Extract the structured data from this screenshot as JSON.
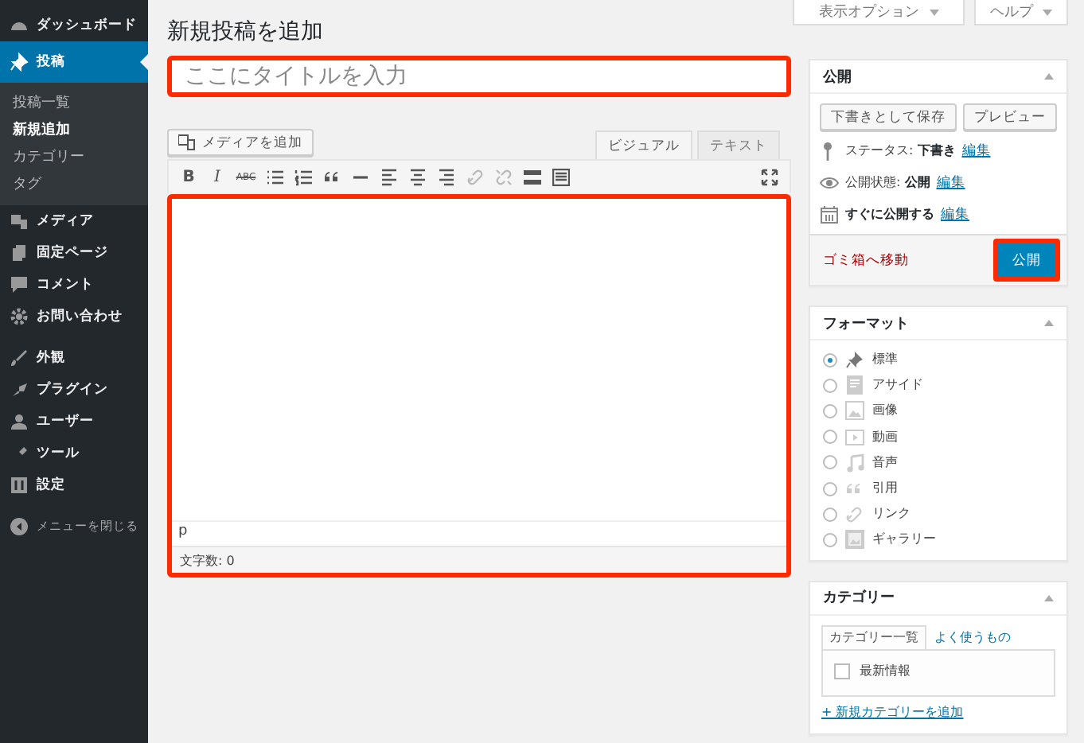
{
  "sidebar": {
    "menu_groups": [
      [
        {
          "label": "ダッシュボード",
          "selected": false
        },
        {
          "label": "投稿",
          "selected": true,
          "children": [
            {
              "label": "投稿一覧",
              "selected": false
            },
            {
              "label": "新規追加",
              "selected": true
            },
            {
              "label": "カテゴリー",
              "selected": false
            },
            {
              "label": "タグ",
              "selected": false
            }
          ]
        },
        {
          "label": "メディア",
          "selected": false
        },
        {
          "label": "固定ページ",
          "selected": false
        },
        {
          "label": "コメント",
          "selected": false
        },
        {
          "label": "お問い合わせ",
          "selected": false
        }
      ],
      [
        {
          "label": "外観",
          "selected": false
        },
        {
          "label": "プラグイン",
          "selected": false
        },
        {
          "label": "ユーザー",
          "selected": false
        },
        {
          "label": "ツール",
          "selected": false
        },
        {
          "label": "設定",
          "selected": false
        }
      ]
    ],
    "collapse": "メニューを閉じる"
  },
  "header_buttons": [
    "表示オプション",
    "ヘルプ"
  ],
  "page_title": "新規投稿を追加",
  "title_field": {
    "placeholder": "ここにタイトルを入力",
    "highlighted": true
  },
  "editor": {
    "media_button": "メディアを追加",
    "tabs": [
      {
        "label": "ビジュアル",
        "selected": true
      },
      {
        "label": "テキスト",
        "selected": false
      }
    ],
    "toolbar_text": [
      "B",
      "I",
      "ABC"
    ],
    "path": "p",
    "word_count": "文字数: 0",
    "highlighted": true
  },
  "publish": {
    "title": "公開",
    "save_draft": "下書きとして保存",
    "preview": "プレビュー",
    "rows": [
      {
        "text": "ステータス: **下書き**",
        "link": "編集"
      },
      {
        "text": "公開状態: **公開**",
        "link": "編集"
      },
      {
        "text": "**すぐに公開する**",
        "link": "編集"
      }
    ],
    "trash": "ゴミ箱へ移動",
    "button": {
      "label": "公開",
      "highlighted": true
    }
  },
  "format": {
    "title": "フォーマット",
    "options": [
      {
        "label": "標準",
        "selected": true
      },
      {
        "label": "アサイド",
        "selected": false
      },
      {
        "label": "画像",
        "selected": false
      },
      {
        "label": "動画",
        "selected": false
      },
      {
        "label": "音声",
        "selected": false
      },
      {
        "label": "引用",
        "selected": false
      },
      {
        "label": "リンク",
        "selected": false
      },
      {
        "label": "ギャラリー",
        "selected": false
      }
    ]
  },
  "category": {
    "title": "カテゴリー",
    "tabs": [
      {
        "label": "カテゴリー一覧",
        "selected": true
      },
      {
        "label": "よく使うもの",
        "selected": false
      }
    ],
    "items": [
      {
        "label": "最新情報",
        "checked": false
      }
    ],
    "add_link": "+ 新規カテゴリーを追加"
  }
}
